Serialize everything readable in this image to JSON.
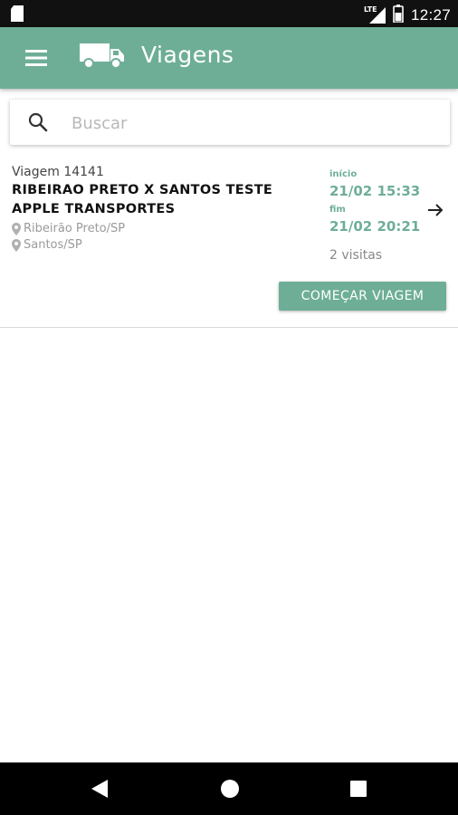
{
  "status_bar": {
    "time": "12:27",
    "network_label": "LTE",
    "icons": [
      "sd-card-icon",
      "signal-icon",
      "battery-icon"
    ]
  },
  "app_bar": {
    "title": "Viagens",
    "icons": [
      "menu-icon",
      "truck-icon"
    ]
  },
  "search": {
    "placeholder": "Buscar",
    "value": ""
  },
  "trips": [
    {
      "id_label": "Viagem 14141",
      "name": "RIBEIRAO PRETO X SANTOS TESTE APPLE TRANSPORTES",
      "origin": "Ribeirão Preto/SP",
      "destination": "Santos/SP",
      "start_label": "início",
      "start_date": "21/02 15:33",
      "end_label": "fim",
      "end_date": "21/02 20:21",
      "visits": "2 visitas",
      "action_label": "COMEÇAR VIAGEM"
    }
  ],
  "colors": {
    "primary": "#6eae97",
    "status_bar": "#111111",
    "nav_bar": "#000000"
  }
}
